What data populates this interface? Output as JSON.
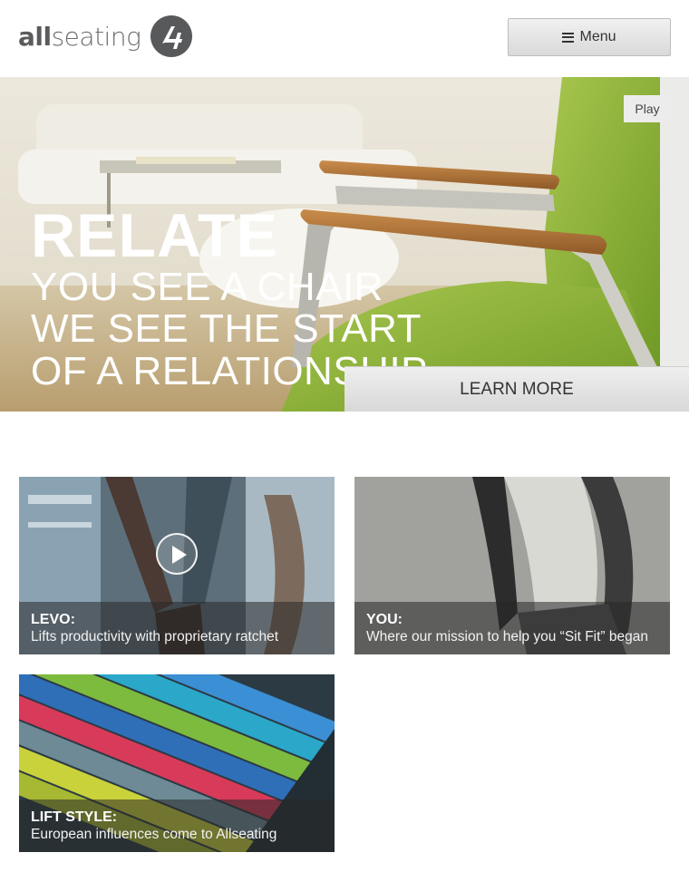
{
  "header": {
    "logo_prefix": "all",
    "logo_suffix": "seating",
    "menu_label": "Menu"
  },
  "hero": {
    "heading": "RELATE",
    "lines": [
      "YOU SEE A CHAIR",
      "WE SEE THE START",
      "OF A RELATIONSHIP"
    ],
    "play_label": "Play",
    "cta_label": "LEARN MORE"
  },
  "tiles": [
    {
      "title": "LEVO:",
      "subtitle": "Lifts productivity with proprietary ratchet",
      "has_video": true
    },
    {
      "title": "YOU:",
      "subtitle": "Where our mission to help you “Sit Fit” began",
      "has_video": false
    },
    {
      "title": "LIFT STYLE:",
      "subtitle": "European influences come to Allseating",
      "has_video": false
    }
  ],
  "colors": {
    "chair_green": "#8fb53a",
    "armrest_wood": "#b5763a",
    "logo_gray": "#58595b"
  },
  "icons": [
    "allseating-logo-icon",
    "hamburger-icon",
    "play-circle-icon"
  ]
}
